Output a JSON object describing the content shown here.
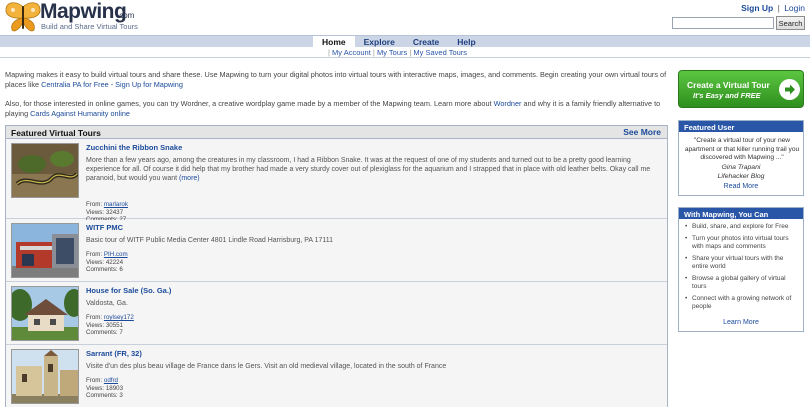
{
  "header": {
    "brand": "Mapwing",
    "brand_suffix": ".com",
    "tagline": "Build and Share Virtual Tours",
    "signup": "Sign Up",
    "separator": "|",
    "login": "Login",
    "search_button": "Search"
  },
  "nav": {
    "tabs": [
      {
        "label": "Home",
        "active": true
      },
      {
        "label": "Explore"
      },
      {
        "label": "Create"
      },
      {
        "label": "Help"
      }
    ],
    "subnav": {
      "my_account": "My Account",
      "my_tours": "My Tours",
      "my_saved_tours": "My Saved Tours",
      "sep": "|"
    }
  },
  "intro": {
    "p1_text": "Mapwing makes it easy to build virtual tours and share these. Use Mapwing to turn your digital photos into virtual tours with interactive maps, images, and comments. Begin creating your own virtual tours of places like ",
    "p1_link": "Centralia PA for Free - Sign Up for Mapwing",
    "p2_text": "Also, for those interested in online games, you can try Wordner, a creative wordplay game made by a member of the Mapwing team. Learn more about ",
    "p2_link1": "Wordner",
    "p2_mid": " and why it is a family friendly alternative to playing ",
    "p2_link2": "Cards Against Humanity online"
  },
  "cta": {
    "title": "Create a Virtual Tour",
    "subtitle": "It's Easy and FREE",
    "accent": "#3aa52a"
  },
  "featured": {
    "title": "Featured Virtual Tours",
    "see_more": "See More",
    "tours": [
      {
        "title": "Zucchini the Ribbon Snake",
        "description": "More than a few years ago, among the creatures in my classroom, I had a Ribbon Snake. It was at the request of one of my students and turned out to be a pretty good learning experience for all. Of course it did help that my brother had made a very sturdy cover out of plexiglass for the aquarium and I strapped that in place with old leather belts. Okay call me paranoid, but would you want",
        "more": "(more)",
        "from_label": "From:",
        "from_user": "marlarok",
        "views": "Views: 32437",
        "comments": "Comments: 27"
      },
      {
        "title": "WITF PMC",
        "description": "Basic tour of WITF Public Media Center 4801 Lindle Road Harrisburg, PA 17111",
        "from_label": "From:",
        "from_user": "PIH.com",
        "views": "Views: 42224",
        "comments": "Comments: 6"
      },
      {
        "title": "House for Sale (So. Ga.)",
        "description": "Valdosta, Ga.",
        "from_label": "From:",
        "from_user": "roylsey172",
        "views": "Views: 30551",
        "comments": "Comments: 7"
      },
      {
        "title": "Sarrant (FR, 32)",
        "description": "Visite d'un des plus beau village de France dans le Gers. Visit an old medieval village, located in the south of France",
        "from_label": "From:",
        "from_user": "odfrd",
        "views": "Views: 18903",
        "comments": "Comments: 3"
      }
    ]
  },
  "featured_user": {
    "title": "Featured User",
    "quote": "\"Create a virtual tour of your new apartment or that killer running trail you discovered with Mapwing ...\"",
    "name": "Gina Trapani",
    "org": "Lifehacker Blog",
    "read_more": "Read More"
  },
  "with_mapwing": {
    "title": "With Mapwing, You Can",
    "items": [
      "Build, share, and explore for Free",
      "Turn your photos into virtual tours with maps and comments",
      "Share your virtual tours with the entire world",
      "Browse a global gallery of virtual tours",
      "Connect with a growing network of people"
    ],
    "learn_more": "Learn More"
  }
}
